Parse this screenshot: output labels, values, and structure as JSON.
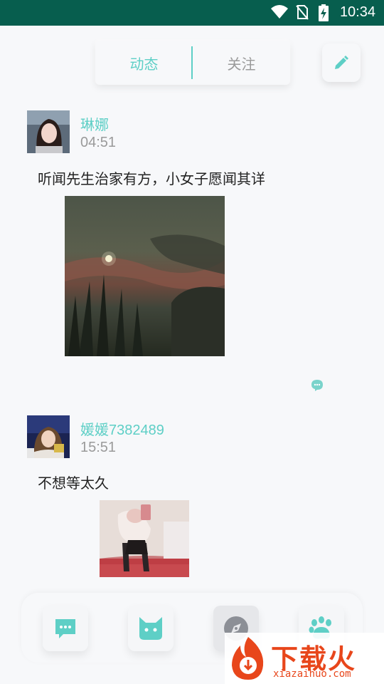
{
  "status_bar": {
    "time": "10:34"
  },
  "header": {
    "tabs": [
      {
        "label": "动态",
        "active": true
      },
      {
        "label": "关注",
        "active": false
      }
    ],
    "accent_color": "#5ecfc6"
  },
  "posts": [
    {
      "username": "琳娜",
      "time": "04:51",
      "text": "听闻先生治家有方，小女子愿闻其详"
    },
    {
      "username": "媛媛7382489",
      "time": "15:51",
      "text": "不想等太久"
    }
  ],
  "bottom_nav": {
    "items": [
      {
        "icon": "chat-bubble-icon",
        "active": false
      },
      {
        "icon": "cat-face-icon",
        "active": false
      },
      {
        "icon": "compass-icon",
        "active": true
      },
      {
        "icon": "paw-icon",
        "active": false
      }
    ]
  },
  "watermark": {
    "brand": "下载火",
    "url": "xiazaihuo.com"
  }
}
